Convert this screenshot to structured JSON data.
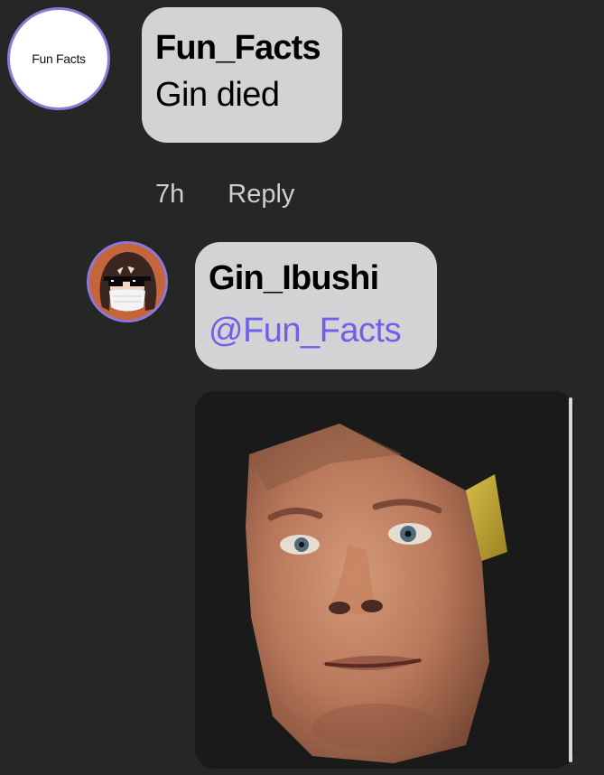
{
  "comments": [
    {
      "avatar_text": "Fun Facts",
      "username": "Fun_Facts",
      "message": "Gin died",
      "time": "7h",
      "reply_label": "Reply"
    },
    {
      "avatar_icon": "anime-character-with-sunglasses-and-mask",
      "username": "Gin_Ibushi",
      "mention": "@Fun_Facts",
      "media_icon": "cutout-face-meme-image"
    }
  ],
  "colors": {
    "background": "#262627",
    "bubble": "#d3d3d5",
    "avatar_ring": "#8f78d6",
    "mention": "#6f5fea",
    "meta_text": "#cfcfcf"
  }
}
